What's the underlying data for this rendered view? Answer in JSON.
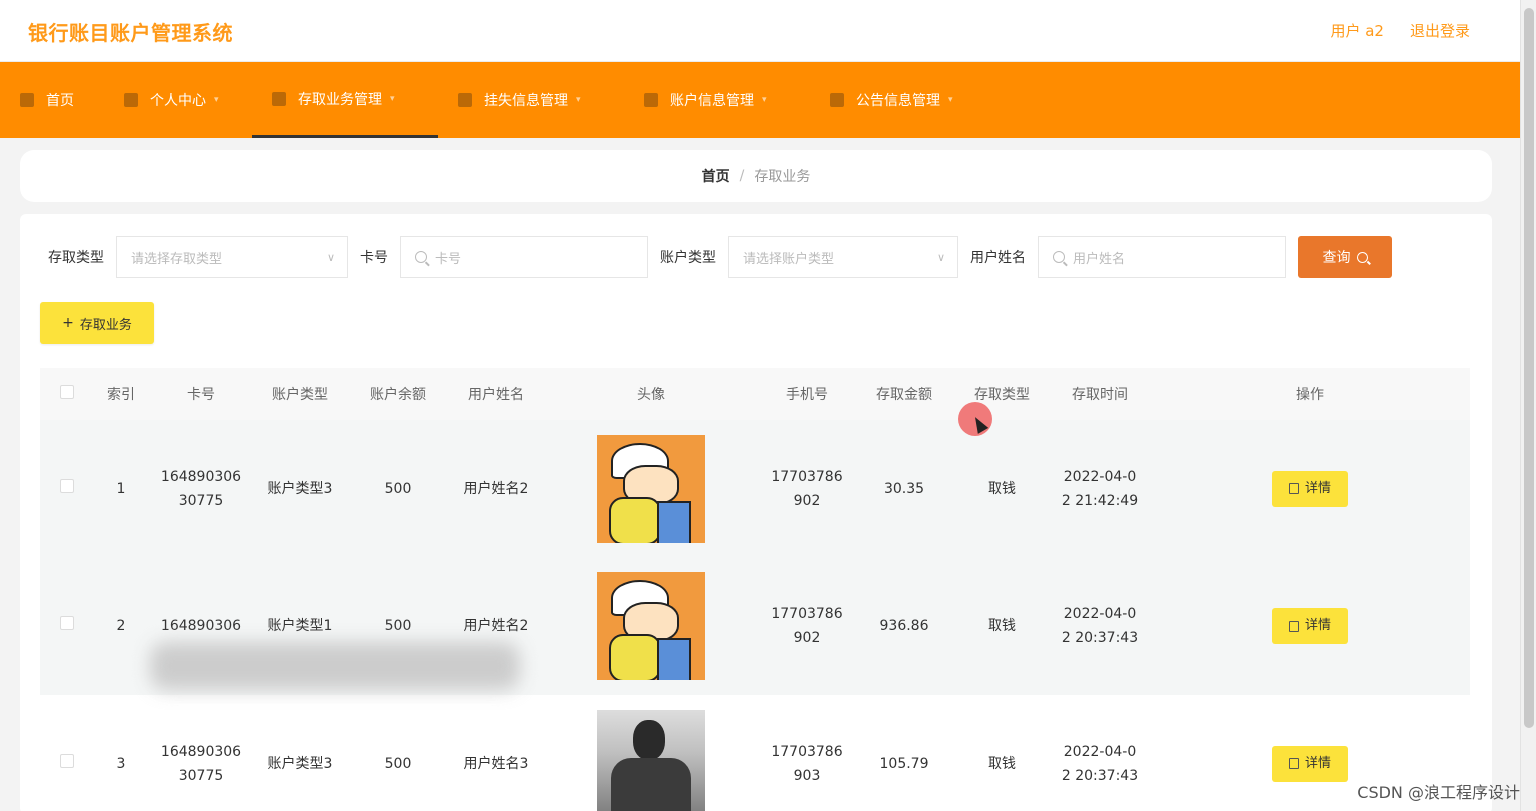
{
  "header": {
    "brand": "银行账目账户管理系统",
    "user": "用户 a2",
    "logout": "退出登录"
  },
  "nav": [
    {
      "label": "首页",
      "icon": "home-icon"
    },
    {
      "label": "个人中心",
      "icon": "user-icon"
    },
    {
      "label": "存取业务管理",
      "icon": "document-icon",
      "active": true
    },
    {
      "label": "挂失信息管理",
      "icon": "document-icon"
    },
    {
      "label": "账户信息管理",
      "icon": "send-icon"
    },
    {
      "label": "公告信息管理",
      "icon": "document-icon"
    }
  ],
  "breadcrumb": {
    "home": "首页",
    "separator": "/",
    "current": "存取业务"
  },
  "search": {
    "type_label": "存取类型",
    "type_placeholder": "请选择存取类型",
    "card_label": "卡号",
    "card_placeholder": "卡号",
    "account_type_label": "账户类型",
    "account_type_placeholder": "请选择账户类型",
    "username_label": "用户姓名",
    "username_placeholder": "用户姓名",
    "query_button": "查询"
  },
  "add_button": "存取业务",
  "table": {
    "headers": [
      "索引",
      "卡号",
      "账户类型",
      "账户余额",
      "用户姓名",
      "头像",
      "手机号",
      "存取金额",
      "存取类型",
      "存取时间",
      "操作"
    ],
    "rows": [
      {
        "index": "1",
        "card_line1": "164890306",
        "card_line2": "30775",
        "account_type": "账户类型3",
        "balance": "500",
        "username": "用户姓名2",
        "avatar": "cartoon",
        "phone_line1": "17703786",
        "phone_line2": "902",
        "amount": "30.35",
        "txn_type": "取钱",
        "time_line1": "2022-04-0",
        "time_line2": "2 21:42:49",
        "action": "详情"
      },
      {
        "index": "2",
        "card_line1": "164890306",
        "card_line2": "",
        "account_type": "账户类型1",
        "balance": "500",
        "username": "用户姓名2",
        "avatar": "cartoon",
        "phone_line1": "17703786",
        "phone_line2": "902",
        "amount": "936.86",
        "txn_type": "取钱",
        "time_line1": "2022-04-0",
        "time_line2": "2 20:37:43",
        "action": "详情"
      },
      {
        "index": "3",
        "card_line1": "164890306",
        "card_line2": "30775",
        "account_type": "账户类型3",
        "balance": "500",
        "username": "用户姓名3",
        "avatar": "photo",
        "phone_line1": "17703786",
        "phone_line2": "903",
        "amount": "105.79",
        "txn_type": "取钱",
        "time_line1": "2022-04-0",
        "time_line2": "2 20:37:43",
        "action": "详情"
      }
    ]
  },
  "watermark": "CSDN @浪工程序设计",
  "colors": {
    "accent": "#ff8c00",
    "brand_text": "#ff9a1a",
    "query_button": "#e9772b",
    "yellow_button": "#fce23b"
  }
}
